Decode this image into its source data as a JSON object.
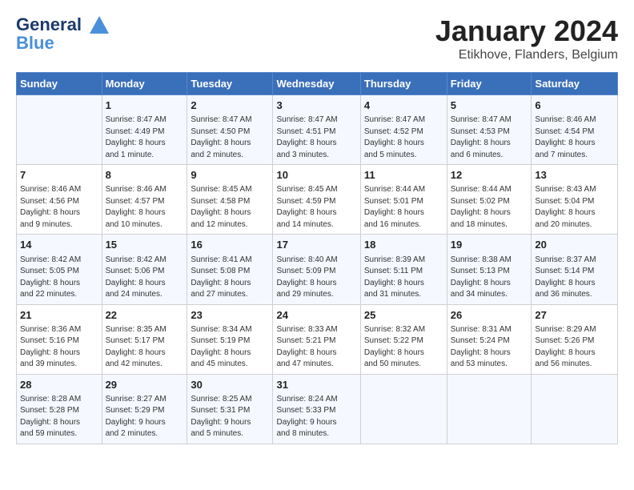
{
  "header": {
    "logo_line1": "General",
    "logo_line2": "Blue",
    "month": "January 2024",
    "location": "Etikhove, Flanders, Belgium"
  },
  "days_header": [
    "Sunday",
    "Monday",
    "Tuesday",
    "Wednesday",
    "Thursday",
    "Friday",
    "Saturday"
  ],
  "weeks": [
    [
      {
        "day": "",
        "info": ""
      },
      {
        "day": "1",
        "info": "Sunrise: 8:47 AM\nSunset: 4:49 PM\nDaylight: 8 hours\nand 1 minute."
      },
      {
        "day": "2",
        "info": "Sunrise: 8:47 AM\nSunset: 4:50 PM\nDaylight: 8 hours\nand 2 minutes."
      },
      {
        "day": "3",
        "info": "Sunrise: 8:47 AM\nSunset: 4:51 PM\nDaylight: 8 hours\nand 3 minutes."
      },
      {
        "day": "4",
        "info": "Sunrise: 8:47 AM\nSunset: 4:52 PM\nDaylight: 8 hours\nand 5 minutes."
      },
      {
        "day": "5",
        "info": "Sunrise: 8:47 AM\nSunset: 4:53 PM\nDaylight: 8 hours\nand 6 minutes."
      },
      {
        "day": "6",
        "info": "Sunrise: 8:46 AM\nSunset: 4:54 PM\nDaylight: 8 hours\nand 7 minutes."
      }
    ],
    [
      {
        "day": "7",
        "info": "Sunrise: 8:46 AM\nSunset: 4:56 PM\nDaylight: 8 hours\nand 9 minutes."
      },
      {
        "day": "8",
        "info": "Sunrise: 8:46 AM\nSunset: 4:57 PM\nDaylight: 8 hours\nand 10 minutes."
      },
      {
        "day": "9",
        "info": "Sunrise: 8:45 AM\nSunset: 4:58 PM\nDaylight: 8 hours\nand 12 minutes."
      },
      {
        "day": "10",
        "info": "Sunrise: 8:45 AM\nSunset: 4:59 PM\nDaylight: 8 hours\nand 14 minutes."
      },
      {
        "day": "11",
        "info": "Sunrise: 8:44 AM\nSunset: 5:01 PM\nDaylight: 8 hours\nand 16 minutes."
      },
      {
        "day": "12",
        "info": "Sunrise: 8:44 AM\nSunset: 5:02 PM\nDaylight: 8 hours\nand 18 minutes."
      },
      {
        "day": "13",
        "info": "Sunrise: 8:43 AM\nSunset: 5:04 PM\nDaylight: 8 hours\nand 20 minutes."
      }
    ],
    [
      {
        "day": "14",
        "info": "Sunrise: 8:42 AM\nSunset: 5:05 PM\nDaylight: 8 hours\nand 22 minutes."
      },
      {
        "day": "15",
        "info": "Sunrise: 8:42 AM\nSunset: 5:06 PM\nDaylight: 8 hours\nand 24 minutes."
      },
      {
        "day": "16",
        "info": "Sunrise: 8:41 AM\nSunset: 5:08 PM\nDaylight: 8 hours\nand 27 minutes."
      },
      {
        "day": "17",
        "info": "Sunrise: 8:40 AM\nSunset: 5:09 PM\nDaylight: 8 hours\nand 29 minutes."
      },
      {
        "day": "18",
        "info": "Sunrise: 8:39 AM\nSunset: 5:11 PM\nDaylight: 8 hours\nand 31 minutes."
      },
      {
        "day": "19",
        "info": "Sunrise: 8:38 AM\nSunset: 5:13 PM\nDaylight: 8 hours\nand 34 minutes."
      },
      {
        "day": "20",
        "info": "Sunrise: 8:37 AM\nSunset: 5:14 PM\nDaylight: 8 hours\nand 36 minutes."
      }
    ],
    [
      {
        "day": "21",
        "info": "Sunrise: 8:36 AM\nSunset: 5:16 PM\nDaylight: 8 hours\nand 39 minutes."
      },
      {
        "day": "22",
        "info": "Sunrise: 8:35 AM\nSunset: 5:17 PM\nDaylight: 8 hours\nand 42 minutes."
      },
      {
        "day": "23",
        "info": "Sunrise: 8:34 AM\nSunset: 5:19 PM\nDaylight: 8 hours\nand 45 minutes."
      },
      {
        "day": "24",
        "info": "Sunrise: 8:33 AM\nSunset: 5:21 PM\nDaylight: 8 hours\nand 47 minutes."
      },
      {
        "day": "25",
        "info": "Sunrise: 8:32 AM\nSunset: 5:22 PM\nDaylight: 8 hours\nand 50 minutes."
      },
      {
        "day": "26",
        "info": "Sunrise: 8:31 AM\nSunset: 5:24 PM\nDaylight: 8 hours\nand 53 minutes."
      },
      {
        "day": "27",
        "info": "Sunrise: 8:29 AM\nSunset: 5:26 PM\nDaylight: 8 hours\nand 56 minutes."
      }
    ],
    [
      {
        "day": "28",
        "info": "Sunrise: 8:28 AM\nSunset: 5:28 PM\nDaylight: 8 hours\nand 59 minutes."
      },
      {
        "day": "29",
        "info": "Sunrise: 8:27 AM\nSunset: 5:29 PM\nDaylight: 9 hours\nand 2 minutes."
      },
      {
        "day": "30",
        "info": "Sunrise: 8:25 AM\nSunset: 5:31 PM\nDaylight: 9 hours\nand 5 minutes."
      },
      {
        "day": "31",
        "info": "Sunrise: 8:24 AM\nSunset: 5:33 PM\nDaylight: 9 hours\nand 8 minutes."
      },
      {
        "day": "",
        "info": ""
      },
      {
        "day": "",
        "info": ""
      },
      {
        "day": "",
        "info": ""
      }
    ]
  ]
}
